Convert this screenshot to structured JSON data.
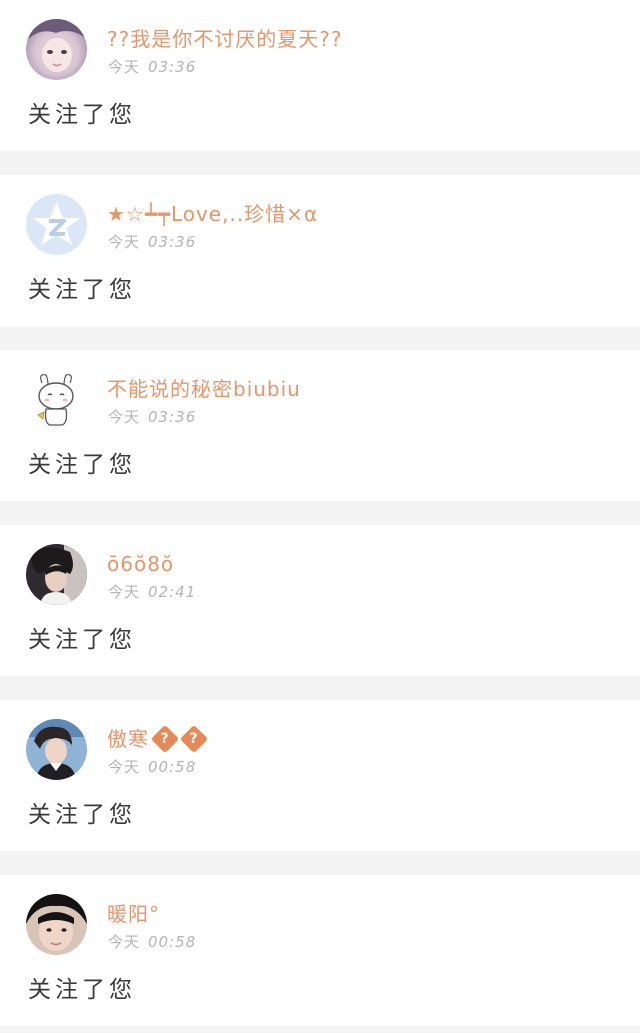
{
  "theme": {
    "name_color": "#e8956a",
    "time_color": "#b4b4b4",
    "message_color": "#3a3a3a",
    "divider_color": "#f4f4f4"
  },
  "notifications": [
    {
      "username": "??我是你不讨厌的夏天??",
      "day": "今天",
      "time": "03:36",
      "message": "关注了您",
      "avatar": "girl-photo-avatar"
    },
    {
      "username": "★☆┷┯Love,..珍惜×α",
      "day": "今天",
      "time": "03:36",
      "message": "关注了您",
      "avatar": "qzone-default-avatar"
    },
    {
      "username": "不能说的秘密biubiu",
      "day": "今天",
      "time": "03:36",
      "message": "关注了您",
      "avatar": "cartoon-bunny-avatar"
    },
    {
      "username": "ō6ŏ8ŏ",
      "day": "今天",
      "time": "02:41",
      "message": "关注了您",
      "avatar": "boy-photo-avatar"
    },
    {
      "username": "傲寒",
      "username_badges": [
        "?",
        "?"
      ],
      "day": "今天",
      "time": "00:58",
      "message": "关注了您",
      "avatar": "boy-blue-background-avatar"
    },
    {
      "username": "暖阳°",
      "day": "今天",
      "time": "00:58",
      "message": "关注了您",
      "avatar": "boy-closeup-avatar"
    }
  ]
}
